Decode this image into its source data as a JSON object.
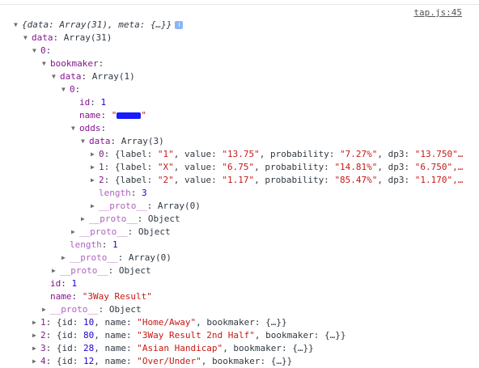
{
  "source_link": "tap.js:45",
  "tree": {
    "root_summary": "{data: Array(31), meta: {…}}",
    "info_badge": "i",
    "data_key": "data",
    "data_val": "Array(31)",
    "item0_key": "0",
    "bookmaker_key": "bookmaker",
    "bk_data_key": "data",
    "bk_data_val": "Array(1)",
    "bk0_key": "0",
    "id_key": "id",
    "id_val": "1",
    "name_key": "name",
    "odds_key": "odds",
    "odds_data_key": "data",
    "odds_data_val": "Array(3)",
    "odds_items": [
      {
        "idx": "0",
        "label": "\"1\"",
        "value": "\"13.75\"",
        "probability": "\"7.27%\"",
        "dp3": "\"13.750\"…"
      },
      {
        "idx": "1",
        "label": "\"X\"",
        "value": "\"6.75\"",
        "probability": "\"14.81%\"",
        "dp3": "\"6.750\",…"
      },
      {
        "idx": "2",
        "label": "\"2\"",
        "value": "\"1.17\"",
        "probability": "\"85.47%\"",
        "dp3": "\"1.170\",…"
      }
    ],
    "length_key": "length",
    "odds_length_val": "3",
    "proto_key": "__proto__",
    "proto_array": "Array(0)",
    "proto_object": "Object",
    "bk_length_val": "1",
    "item0_id_val": "1",
    "item0_name_val": "\"3Way Result\"",
    "rows": [
      {
        "idx": "1",
        "id": "10",
        "name": "\"Home/Away\""
      },
      {
        "idx": "2",
        "id": "80",
        "name": "\"3Way Result 2nd Half\""
      },
      {
        "idx": "3",
        "id": "28",
        "name": "\"Asian Handicap\""
      },
      {
        "idx": "4",
        "id": "12",
        "name": "\"Over/Under\""
      }
    ],
    "bookmaker_short": "{…}"
  }
}
